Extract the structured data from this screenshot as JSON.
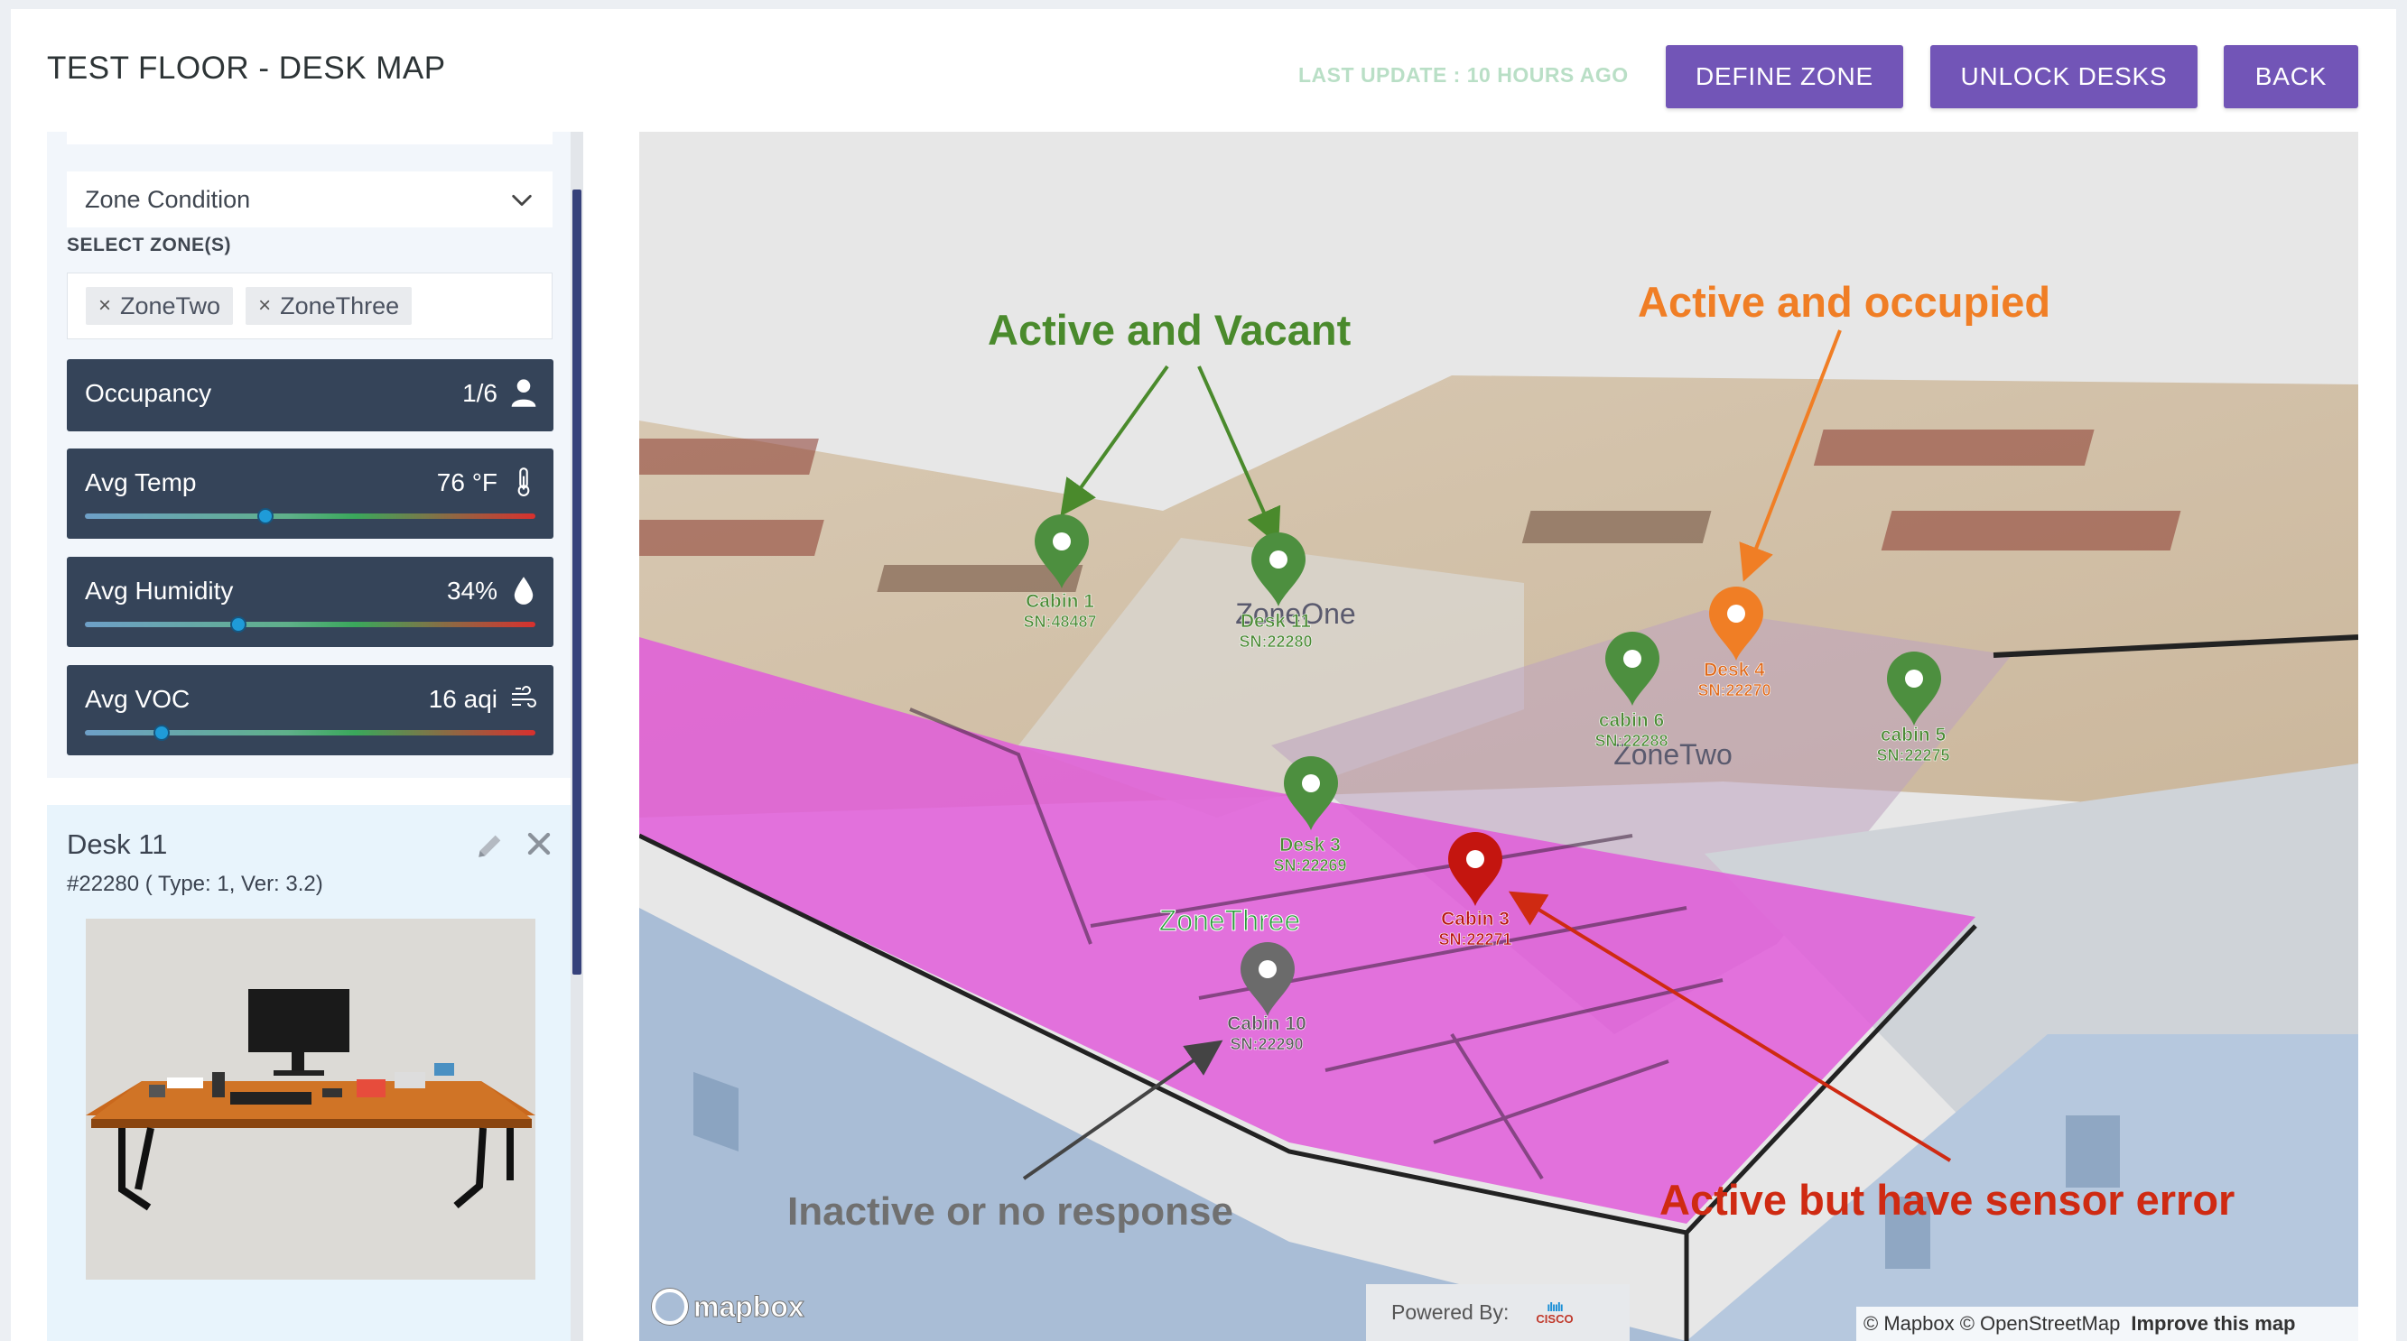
{
  "header": {
    "title": "TEST FLOOR - DESK MAP",
    "last_update": "LAST UPDATE : 10 HOURS AGO",
    "buttons": {
      "define_zone": "DEFINE ZONE",
      "unlock_desks": "UNLOCK DESKS",
      "back": "BACK"
    }
  },
  "sidebar": {
    "zone_condition": "Zone Condition",
    "select_zones_label": "SELECT ZONE(S)",
    "selected_zones": [
      "ZoneTwo",
      "ZoneThree"
    ],
    "remove_glyph": "×",
    "metrics": {
      "occupancy": {
        "label": "Occupancy",
        "value": "1/6",
        "icon": "person-icon"
      },
      "avg_temp": {
        "label": "Avg Temp",
        "value": "76 °F",
        "icon": "thermometer-icon",
        "level": 0.4
      },
      "avg_humidity": {
        "label": "Avg Humidity",
        "value": "34%",
        "icon": "droplet-icon",
        "level": 0.34
      },
      "avg_voc": {
        "label": "Avg VOC",
        "value": "16 aqi",
        "icon": "wind-icon",
        "level": 0.17
      }
    }
  },
  "desk_card": {
    "title": "Desk 11",
    "subtitle": "#22280 ( Type: 1, Ver: 3.2)"
  },
  "map": {
    "annotations": {
      "vacant": "Active and Vacant",
      "occupied": "Active and occupied",
      "inactive": "Inactive or no response",
      "error": "Active but have sensor error"
    },
    "zones": {
      "one": "ZoneOne",
      "two": "ZoneTwo",
      "three": "ZoneThree"
    },
    "pins": [
      {
        "name": "Cabin 1",
        "sn": "SN:48487",
        "status": "vacant",
        "color": "#4d8f3f"
      },
      {
        "name": "Desk 11",
        "sn": "SN:22280",
        "status": "vacant",
        "color": "#4d8f3f"
      },
      {
        "name": "Desk 4",
        "sn": "SN:22270",
        "status": "occupied",
        "color": "#f07e25"
      },
      {
        "name": "cabin 6",
        "sn": "SN:22288",
        "status": "vacant",
        "color": "#4d8f3f"
      },
      {
        "name": "cabin 5",
        "sn": "SN:22275",
        "status": "vacant",
        "color": "#4d8f3f"
      },
      {
        "name": "Desk 3",
        "sn": "SN:22269",
        "status": "vacant",
        "color": "#4d8f3f"
      },
      {
        "name": "Cabin 3",
        "sn": "SN:22271",
        "status": "error",
        "color": "#c4150f"
      },
      {
        "name": "Cabin 10",
        "sn": "SN:22290",
        "status": "inactive",
        "color": "#6b6b6b"
      }
    ],
    "mapbox_logo": "mapbox",
    "powered_by": "Powered By:",
    "cisco": "CISCO",
    "attribution": "© Mapbox © OpenStreetMap",
    "improve": "Improve this map"
  }
}
